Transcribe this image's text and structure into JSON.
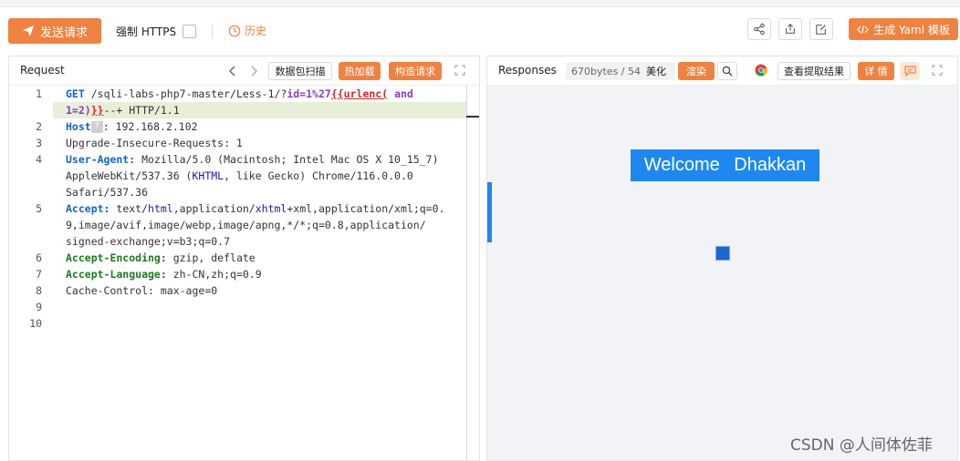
{
  "toolbar": {
    "send_label": "发送请求",
    "https_label": "强制 HTTPS",
    "history_label": "历史",
    "yaml_label": "生成 Yaml 模板"
  },
  "request": {
    "title": "Request",
    "scan_label": "数据包扫描",
    "hot_label": "热加载",
    "build_label": "构造请求",
    "line_numbers": [
      "1",
      "2",
      "3",
      "4",
      "5",
      "6",
      "7",
      "8",
      "9",
      "10"
    ],
    "lines": {
      "l1a_method": "GET",
      "l1a_path": "/sqli-labs-php7-master/Less-1/?",
      "l1a_param": "id=1%27",
      "l1a_tag": "{{urlenc(",
      "l1a_and": "and",
      "l1b_expr": "1=2)",
      "l1b_close": "}}",
      "l1b_rest": "--+ HTTP/1.1",
      "l2_key": "Host",
      "l2_badge": "?",
      "l2_val": ": 192.168.2.102",
      "l3": "Upgrade-Insecure-Requests: 1",
      "l4_key": "User-Agent:",
      "l4_val": " Mozilla/5.0 (Macintosh; Intel Mac OS X 10_15_7)",
      "l4b_a": "AppleWebKit/537.36 (",
      "l4b_k": "KHTML",
      "l4b_b": ", like Gecko) Chrome/116.0.0.0",
      "l4c": "Safari/537.36",
      "l5_key": "Accept:",
      "l5_a": " text/",
      "l5_html": "html",
      "l5_b": ",application/",
      "l5_x": "xhtml",
      "l5_c": "+xml,application/xml;q=0.",
      "l5b": "9,image/avif,image/webp,image/apng,*/*;q=0.8,application/",
      "l5c": "signed-exchange;v=b3;q=0.7",
      "l6_key": "Accept-Encoding:",
      "l6_val": " gzip, deflate",
      "l7_key": "Accept-Language:",
      "l7_val": " zh-CN,zh;q=0.9",
      "l8": "Cache-Control: max-age=0"
    }
  },
  "response": {
    "title": "Responses",
    "size": "670bytes / 54",
    "beautify_label": "美化",
    "render_label": "渲染",
    "extract_label": "查看提取结果",
    "detail_label": "详 情",
    "welcome_text": "Welcome Dhakkan"
  },
  "watermark": "CSDN @人间体佐菲",
  "colors": {
    "accent": "#f08241",
    "link_blue": "#1e88f0",
    "highlight_line": "#e8efd8"
  },
  "icons": [
    "send-icon",
    "clock-icon",
    "share-icon",
    "export-icon",
    "edit-icon",
    "code-icon",
    "chevron-left-icon",
    "chevron-right-icon",
    "expand-icon",
    "search-icon",
    "chrome-icon",
    "comment-icon"
  ]
}
